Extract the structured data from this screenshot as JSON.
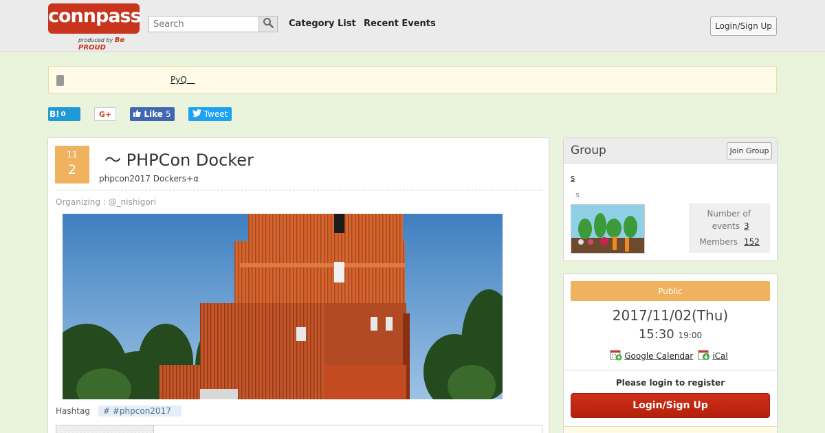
{
  "header": {
    "logo_text": "connpass",
    "logo_sub": "produced by",
    "logo_sub_brand": "Be PROUD",
    "search_placeholder": "Search",
    "nav": [
      "Category List",
      "Recent Events"
    ],
    "login_label": "Login/Sign Up"
  },
  "notice": {
    "link_text": "PyQ  "
  },
  "social": {
    "hatena_label": "B!",
    "hatena_count": "0",
    "gplus_label": "G+",
    "like_label": "Like",
    "like_count": "5",
    "tweet_label": "Tweet"
  },
  "event": {
    "month": "11",
    "day": "2",
    "title": "～ PHPCon Docker",
    "subtitle": "phpcon2017 Dockers+α",
    "organizing_label": "Organizing :",
    "organizer": "@_nishigori",
    "hashtag_label": "Hashtag",
    "hashtag": "# #phpcon2017"
  },
  "group": {
    "title": "Group",
    "join_label": "Join Group",
    "name": "s",
    "description": "s",
    "events_label_1": "Number of",
    "events_label_2": "events",
    "events_count": "3",
    "members_label": "Members",
    "members_count": "152"
  },
  "schedule": {
    "visibility": "Public",
    "date": "2017/11/02(Thu)",
    "start_time": "15:30",
    "end_time": "19:00",
    "google_calendar_label": "Google Calendar",
    "ical_label": "iCal",
    "please_login": "Please login to register",
    "login_button": "Login/Sign Up"
  },
  "colors": {
    "brand_red": "#c8341c",
    "accent_orange": "#f0b25f",
    "page_green": "#eaf3dc"
  }
}
